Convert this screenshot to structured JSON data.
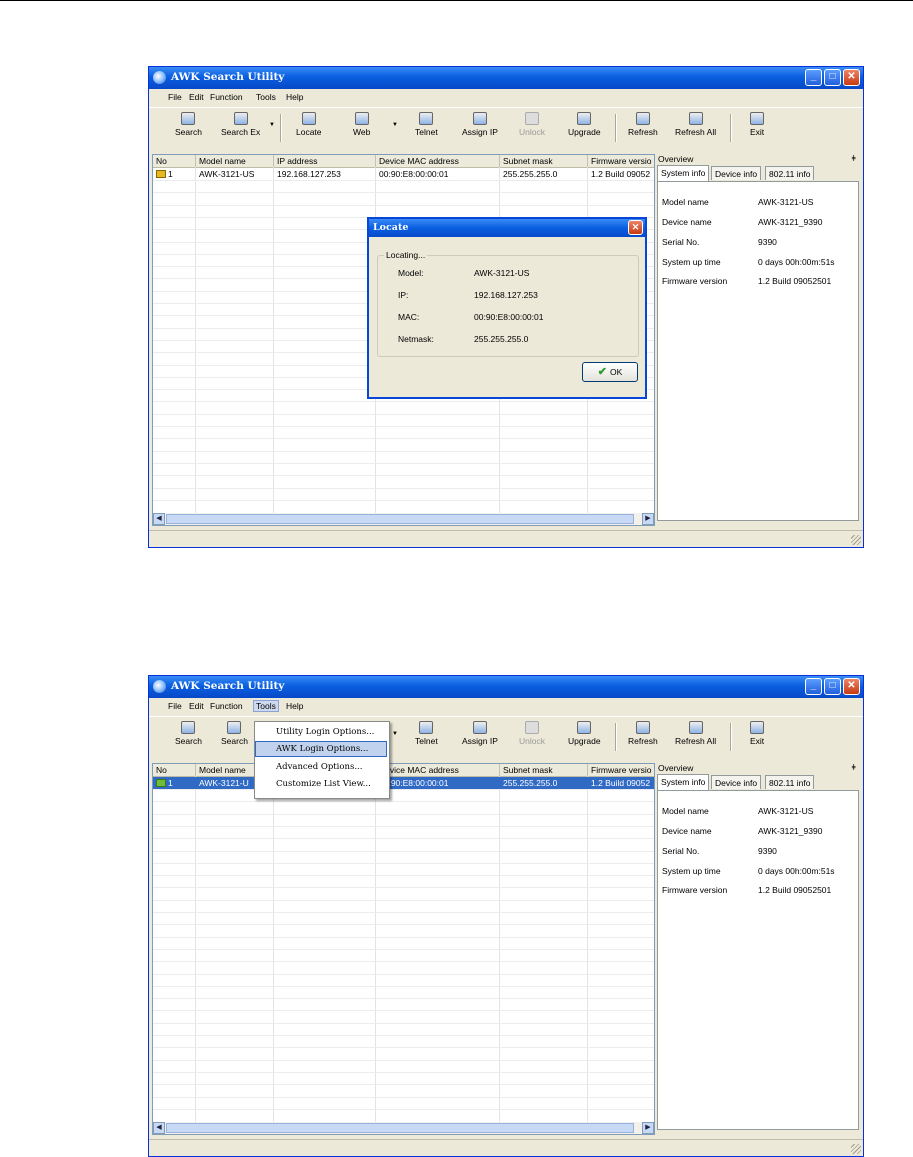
{
  "screenshots": [
    {
      "window_title": "AWK Search Utility",
      "menu": [
        "File",
        "Edit",
        "Function",
        "Tools",
        "Help"
      ],
      "toolbar": [
        "Search",
        "Search Ex",
        "Locate",
        "Web",
        "Telnet",
        "Assign IP",
        "Unlock",
        "Upgrade",
        "Refresh",
        "Refresh All",
        "Exit"
      ],
      "columns": [
        "No",
        "Model name",
        "IP address",
        "Device MAC address",
        "Subnet mask",
        "Firmware versio"
      ],
      "row": {
        "no": "1",
        "model": "AWK-3121-US",
        "ip": "192.168.127.253",
        "mac": "00:90:E8:00:00:01",
        "mask": "255.255.255.0",
        "firmware": "1.2 Build 09052"
      },
      "overview_title": "Overview",
      "tabs": [
        "System info",
        "Device info",
        "802.11 info"
      ],
      "info": [
        {
          "label": "Model name",
          "value": "AWK-3121-US"
        },
        {
          "label": "Device name",
          "value": "AWK-3121_9390"
        },
        {
          "label": "Serial No.",
          "value": "9390"
        },
        {
          "label": "System up time",
          "value": "0 days 00h:00m:51s"
        },
        {
          "label": "Firmware version",
          "value": "1.2 Build 09052501"
        }
      ],
      "dialog": {
        "title": "Locate",
        "group": "Locating...",
        "fields": [
          {
            "label": "Model:",
            "value": "AWK-3121-US"
          },
          {
            "label": "IP:",
            "value": "192.168.127.253"
          },
          {
            "label": "MAC:",
            "value": "00:90:E8:00:00:01"
          },
          {
            "label": "Netmask:",
            "value": "255.255.255.0"
          }
        ],
        "ok": "OK"
      }
    },
    {
      "window_title": "AWK Search Utility",
      "menu": [
        "File",
        "Edit",
        "Function",
        "Tools",
        "Help"
      ],
      "toolbar": [
        "Search",
        "Search",
        "Telnet",
        "Assign IP",
        "Unlock",
        "Upgrade",
        "Refresh",
        "Refresh All",
        "Exit"
      ],
      "columns": [
        "No",
        "Model name",
        "Device MAC address",
        "Subnet mask",
        "Firmware versio"
      ],
      "row": {
        "no": "1",
        "model": "AWK-3121-U",
        "mac": "00:90:E8:00:00:01",
        "mask": "255.255.255.0",
        "firmware": "1.2 Build 09052"
      },
      "overview_title": "Overview",
      "tabs": [
        "System info",
        "Device info",
        "802.11 info"
      ],
      "info": [
        {
          "label": "Model name",
          "value": "AWK-3121-US"
        },
        {
          "label": "Device name",
          "value": "AWK-3121_9390"
        },
        {
          "label": "Serial No.",
          "value": "9390"
        },
        {
          "label": "System up time",
          "value": "0 days 00h:00m:51s"
        },
        {
          "label": "Firmware version",
          "value": "1.2 Build 09052501"
        }
      ],
      "tools_menu": [
        "Utility Login Options...",
        "AWK Login Options...",
        "Advanced Options...",
        "Customize List View..."
      ]
    }
  ]
}
